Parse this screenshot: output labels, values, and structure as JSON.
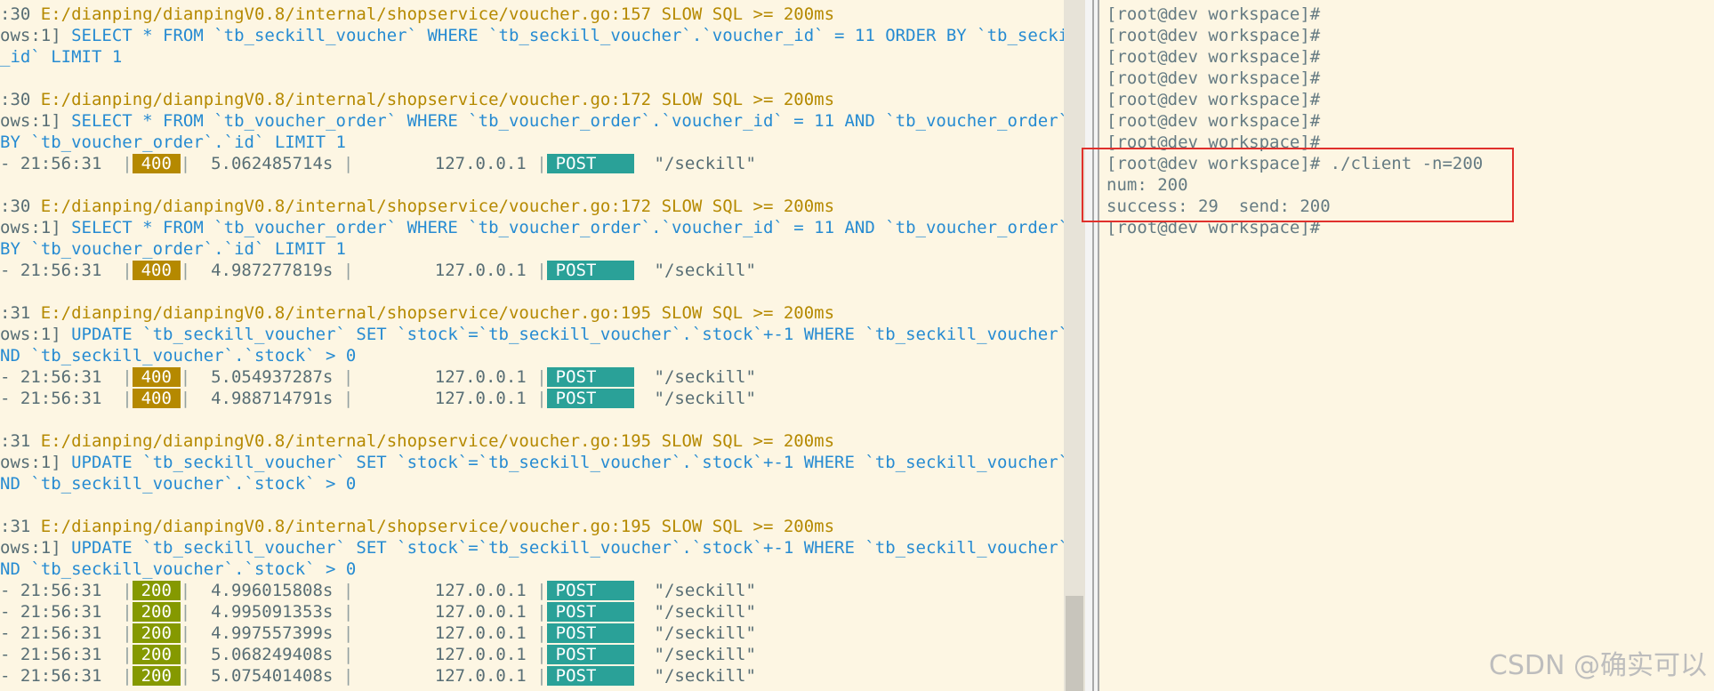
{
  "left_terminal": {
    "lines": [
      {
        "kind": "sql_header",
        "time": ":30",
        "path": "E:/dianping/dianpingV0.8/internal/shopservice/voucher.go:157",
        "tag": "SLOW SQL >= 200ms"
      },
      {
        "kind": "sql_rows",
        "rows": "ows:1]",
        "sql": "SELECT * FROM `tb_seckill_voucher` WHERE `tb_seckill_voucher`.`voucher_id` = 11 ORDER BY `tb_seckill_v"
      },
      {
        "kind": "sql_cont",
        "sql": "_id` LIMIT 1"
      },
      {
        "kind": "blank"
      },
      {
        "kind": "sql_header",
        "time": ":30",
        "path": "E:/dianping/dianpingV0.8/internal/shopservice/voucher.go:172",
        "tag": "SLOW SQL >= 200ms"
      },
      {
        "kind": "sql_rows",
        "rows": "ows:1]",
        "sql": "SELECT * FROM `tb_voucher_order` WHERE `tb_voucher_order`.`voucher_id` = 11 AND `tb_voucher_order`.`us"
      },
      {
        "kind": "sql_cont",
        "sql": "BY `tb_voucher_order`.`id` LIMIT 1"
      },
      {
        "kind": "req",
        "time": "- 21:56:31",
        "status": "400",
        "latency": "5.062485714s",
        "ip": "127.0.0.1",
        "method": "POST",
        "path": "\"/seckill\""
      },
      {
        "kind": "blank"
      },
      {
        "kind": "sql_header",
        "time": ":30",
        "path": "E:/dianping/dianpingV0.8/internal/shopservice/voucher.go:172",
        "tag": "SLOW SQL >= 200ms"
      },
      {
        "kind": "sql_rows",
        "rows": "ows:1]",
        "sql": "SELECT * FROM `tb_voucher_order` WHERE `tb_voucher_order`.`voucher_id` = 11 AND `tb_voucher_order`.`us"
      },
      {
        "kind": "sql_cont",
        "sql": "BY `tb_voucher_order`.`id` LIMIT 1"
      },
      {
        "kind": "req",
        "time": "- 21:56:31",
        "status": "400",
        "latency": "4.987277819s",
        "ip": "127.0.0.1",
        "method": "POST",
        "path": "\"/seckill\""
      },
      {
        "kind": "blank"
      },
      {
        "kind": "sql_header",
        "time": ":31",
        "path": "E:/dianping/dianpingV0.8/internal/shopservice/voucher.go:195",
        "tag": "SLOW SQL >= 200ms"
      },
      {
        "kind": "sql_rows",
        "rows": "ows:1]",
        "sql": "UPDATE `tb_seckill_voucher` SET `stock`=`tb_seckill_voucher`.`stock`+-1 WHERE `tb_seckill_voucher`.`vo"
      },
      {
        "kind": "sql_cont",
        "sql": "ND `tb_seckill_voucher`.`stock` > 0"
      },
      {
        "kind": "req",
        "time": "- 21:56:31",
        "status": "400",
        "latency": "5.054937287s",
        "ip": "127.0.0.1",
        "method": "POST",
        "path": "\"/seckill\""
      },
      {
        "kind": "req",
        "time": "- 21:56:31",
        "status": "400",
        "latency": "4.988714791s",
        "ip": "127.0.0.1",
        "method": "POST",
        "path": "\"/seckill\""
      },
      {
        "kind": "blank"
      },
      {
        "kind": "sql_header",
        "time": ":31",
        "path": "E:/dianping/dianpingV0.8/internal/shopservice/voucher.go:195",
        "tag": "SLOW SQL >= 200ms"
      },
      {
        "kind": "sql_rows",
        "rows": "ows:1]",
        "sql": "UPDATE `tb_seckill_voucher` SET `stock`=`tb_seckill_voucher`.`stock`+-1 WHERE `tb_seckill_voucher`.`vo"
      },
      {
        "kind": "sql_cont",
        "sql": "ND `tb_seckill_voucher`.`stock` > 0"
      },
      {
        "kind": "blank"
      },
      {
        "kind": "sql_header",
        "time": ":31",
        "path": "E:/dianping/dianpingV0.8/internal/shopservice/voucher.go:195",
        "tag": "SLOW SQL >= 200ms"
      },
      {
        "kind": "sql_rows",
        "rows": "ows:1]",
        "sql": "UPDATE `tb_seckill_voucher` SET `stock`=`tb_seckill_voucher`.`stock`+-1 WHERE `tb_seckill_voucher`.`vo"
      },
      {
        "kind": "sql_cont",
        "sql": "ND `tb_seckill_voucher`.`stock` > 0"
      },
      {
        "kind": "req",
        "time": "- 21:56:31",
        "status": "200",
        "latency": "4.996015808s",
        "ip": "127.0.0.1",
        "method": "POST",
        "path": "\"/seckill\""
      },
      {
        "kind": "req",
        "time": "- 21:56:31",
        "status": "200",
        "latency": "4.995091353s",
        "ip": "127.0.0.1",
        "method": "POST",
        "path": "\"/seckill\""
      },
      {
        "kind": "req",
        "time": "- 21:56:31",
        "status": "200",
        "latency": "4.997557399s",
        "ip": "127.0.0.1",
        "method": "POST",
        "path": "\"/seckill\""
      },
      {
        "kind": "req",
        "time": "- 21:56:31",
        "status": "200",
        "latency": "5.068249408s",
        "ip": "127.0.0.1",
        "method": "POST",
        "path": "\"/seckill\""
      },
      {
        "kind": "req",
        "time": "- 21:56:31",
        "status": "200",
        "latency": "5.075401408s",
        "ip": "127.0.0.1",
        "method": "POST",
        "path": "\"/seckill\""
      }
    ]
  },
  "right_terminal": {
    "lines": [
      "[root@dev workspace]#",
      "[root@dev workspace]#",
      "[root@dev workspace]#",
      "[root@dev workspace]#",
      "[root@dev workspace]#",
      "[root@dev workspace]#",
      "[root@dev workspace]#",
      "[root@dev workspace]# ./client -n=200",
      "num: 200",
      "success: 29  send: 200",
      "[root@dev workspace]#"
    ]
  },
  "watermark": "CSDN @确实可以",
  "colors": {
    "status_400": "#b58900",
    "status_200": "#859900",
    "method_bg": "#2aa198",
    "highlight_box": "#e0302c"
  }
}
